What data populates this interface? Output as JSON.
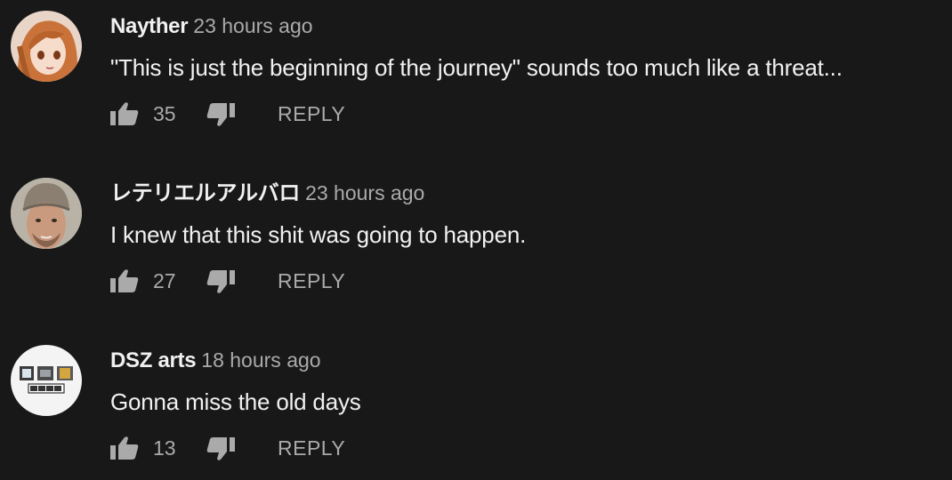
{
  "colors": {
    "background": "#181818",
    "primary_text": "#f1f1f1",
    "secondary_text": "#aaaaaa"
  },
  "comments": [
    {
      "author": "Nayther",
      "time": "23 hours ago",
      "text": "\"This is just the beginning of the journey\" sounds too much like a threat...",
      "likes": "35",
      "reply_label": "REPLY",
      "avatar_icon": "anime-girl-avatar"
    },
    {
      "author": "レテリエルアルバロ",
      "time": "23 hours ago",
      "text": "I knew that this shit was going to happen.",
      "likes": "27",
      "reply_label": "REPLY",
      "avatar_icon": "man-in-beanie-avatar"
    },
    {
      "author": "DSZ arts",
      "time": "18 hours ago",
      "text": "Gonna miss the old days",
      "likes": "13",
      "reply_label": "REPLY",
      "avatar_icon": "dsz-arts-logo-avatar"
    }
  ]
}
